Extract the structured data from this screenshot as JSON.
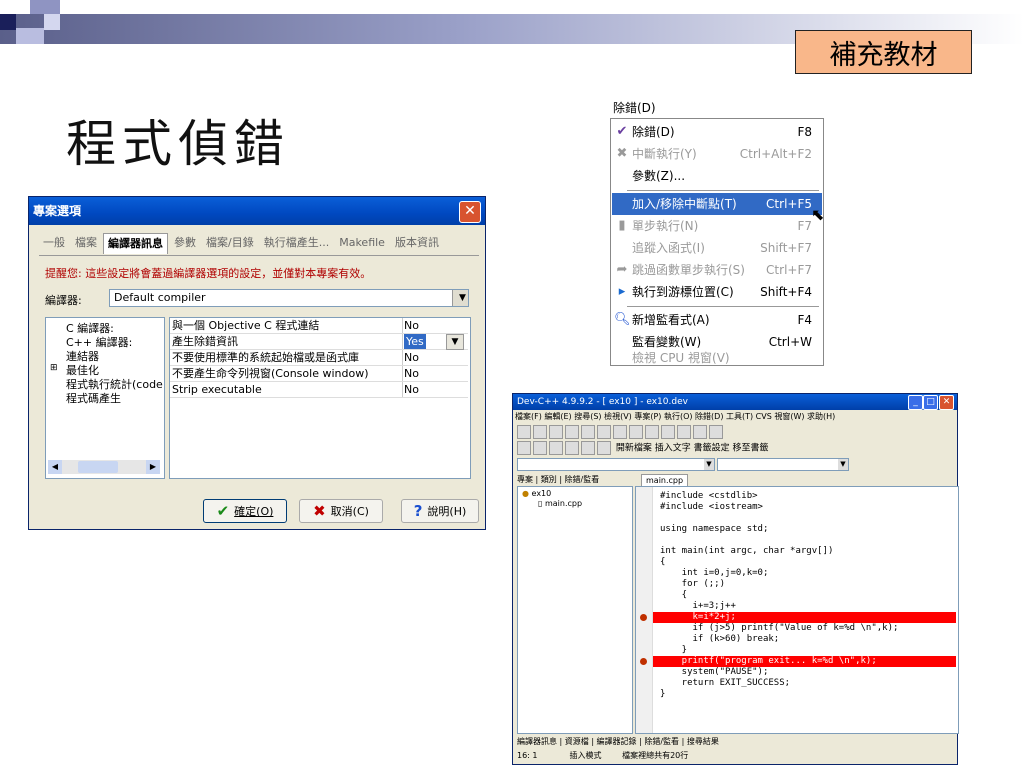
{
  "badge": "補充教材",
  "title": "程式偵錯",
  "colors": {
    "badge_bg": "#f9b78a",
    "xp_blue": "#0a5fd8",
    "highlight": "#316ac5",
    "breakpoint": "#ff0000"
  },
  "dialog": {
    "title": "專案選項",
    "tabs": [
      "一般",
      "檔案",
      "編譯器訊息",
      "參數",
      "檔案/目錄",
      "執行檔產生...",
      "Makefile",
      "版本資訊"
    ],
    "active_tab": 2,
    "tip": "提醒您: 這些設定將會蓋過編譯器選項的設定，並僅對本專案有效。",
    "compiler_label": "編譯器:",
    "compiler_value": "Default compiler",
    "tree": [
      "C 編譯器:",
      "C++ 編譯器:",
      "連結器",
      "最佳化",
      "程式執行統計(code",
      "程式碼產生"
    ],
    "options": [
      {
        "name": "與一個 Objective C 程式連結",
        "value": "No"
      },
      {
        "name": "產生除錯資訊",
        "value": "Yes"
      },
      {
        "name": "不要使用標準的系統起始檔或是函式庫",
        "value": "No"
      },
      {
        "name": "不要產生命令列視窗(Console window)",
        "value": "No"
      },
      {
        "name": "Strip executable",
        "value": "No"
      }
    ],
    "ok": "確定(O)",
    "cancel": "取消(C)",
    "help": "說明(H)"
  },
  "menu": {
    "title": "除錯(D)",
    "items": [
      {
        "icon": "check-icon",
        "label": "除錯(D)",
        "shortcut": "F8",
        "disabled": false
      },
      {
        "icon": "stop-icon",
        "label": "中斷執行(Y)",
        "shortcut": "Ctrl+Alt+F2",
        "disabled": true
      },
      {
        "icon": "",
        "label": "參數(Z)...",
        "shortcut": "",
        "disabled": false
      },
      {
        "icon": "",
        "label": "加入/移除中斷點(T)",
        "shortcut": "Ctrl+F5",
        "disabled": false
      },
      {
        "icon": "step-icon",
        "label": "單步執行(N)",
        "shortcut": "F7",
        "disabled": true
      },
      {
        "icon": "",
        "label": "追蹤入函式(I)",
        "shortcut": "Shift+F7",
        "disabled": true
      },
      {
        "icon": "jump-icon",
        "label": "跳過函數單步執行(S)",
        "shortcut": "Ctrl+F7",
        "disabled": true
      },
      {
        "icon": "cursor-icon",
        "label": "執行到游標位置(C)",
        "shortcut": "Shift+F4",
        "disabled": false
      },
      {
        "icon": "watch-icon",
        "label": "新增監看式(A)",
        "shortcut": "F4",
        "disabled": false
      },
      {
        "icon": "",
        "label": "監看變數(W)",
        "shortcut": "Ctrl+W",
        "disabled": false
      },
      {
        "icon": "",
        "label": "檢視 CPU 視窗(V)",
        "shortcut": "",
        "disabled": true
      }
    ],
    "highlighted": 3
  },
  "ide": {
    "title": "Dev-C++ 4.9.9.2 - [ ex10 ] - ex10.dev",
    "menubar": "檔案(F)  編輯(E)  搜尋(S)  檢視(V)  專案(P)  執行(O)  除錯(D)  工具(T)  CVS  視窗(W)  求助(H)",
    "toolbar2": "開新檔案   插入文字   書籤設定   移至書籤",
    "panel_tabs": "專案 | 類別 | 除錯/監看",
    "editor_tab": "main.cpp",
    "project_root": "ex10",
    "project_file": "main.cpp",
    "code": [
      "#include <cstdlib>",
      "#include <iostream>",
      "",
      "using namespace std;",
      "",
      "int main(int argc, char *argv[])",
      "{",
      "    int i=0,j=0,k=0;",
      "    for (;;)",
      "    {",
      "      i+=3;j++",
      "      k=i*2+j;",
      "      if (j>5) printf(\"Value of k=%d \\n\",k);",
      "      if (k>60) break;",
      "    }",
      "    printf(\"program exit... k=%d \\n\",k);",
      "    system(\"PAUSE\");",
      "    return EXIT_SUCCESS;",
      "}"
    ],
    "breakpoint_lines": [
      11,
      15
    ],
    "bottom_tabs": "編譯器訊息 | 資源檔 | 編譯器記錄 | 除錯/監看 | 搜尋結果",
    "status": [
      "16: 1",
      "插入模式",
      "檔案裡總共有20行"
    ]
  }
}
